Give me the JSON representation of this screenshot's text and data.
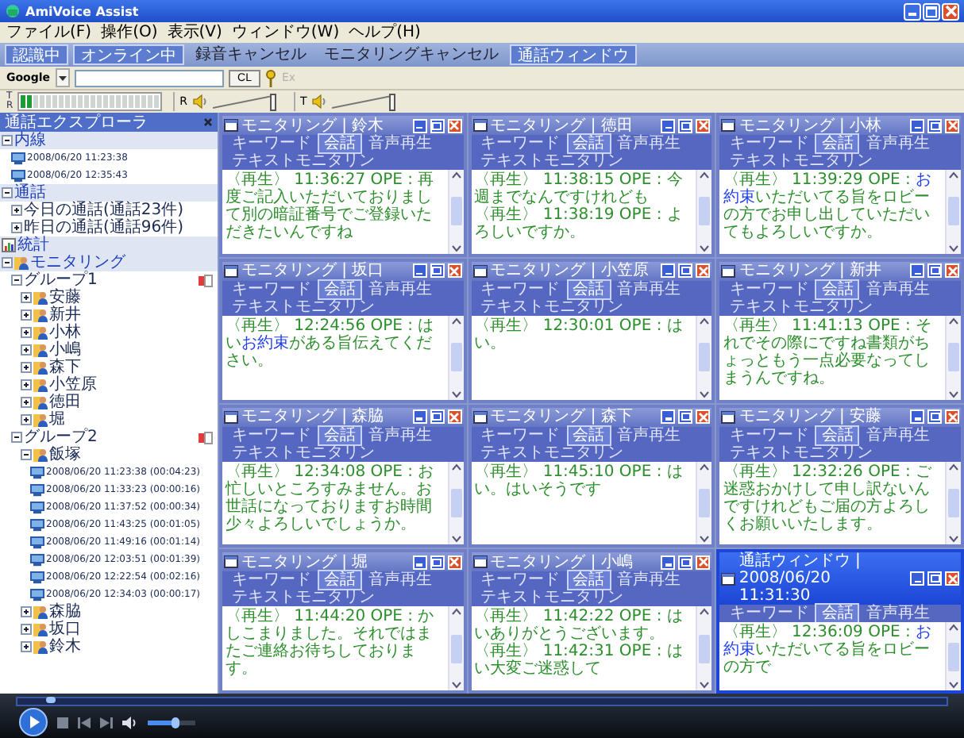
{
  "app_title": "AmiVoice Assist",
  "menu": [
    "ファイル(F)",
    "操作(O)",
    "表示(V)",
    "ウィンドウ(W)",
    "ヘルプ(H)"
  ],
  "toolbar": [
    {
      "label": "認識中",
      "on": true
    },
    {
      "label": "オンライン中",
      "on": true
    },
    {
      "label": "録音キャンセル",
      "on": false
    },
    {
      "label": "モニタリングキャンセル",
      "on": false
    },
    {
      "label": "通話ウィンドウ",
      "on": true
    }
  ],
  "search": {
    "engine": "Google",
    "button": "CL",
    "ex_button": {
      "label": "Ex",
      "disabled": true
    }
  },
  "meter": {
    "top_label": "T",
    "bottom_label": "R",
    "level": 0.1
  },
  "sliders": [
    {
      "label": "R",
      "level": 0.95
    },
    {
      "label": "T",
      "level": 0.95
    }
  ],
  "explorer": {
    "title": "通話エクスプローラ",
    "tree": [
      {
        "label": "内線",
        "kind": "section",
        "expanded": true,
        "children": [
          {
            "label": "2008/06/20 11:23:38",
            "kind": "record"
          },
          {
            "label": "2008/06/20 12:35:43",
            "kind": "record"
          }
        ]
      },
      {
        "label": "通話",
        "kind": "section",
        "expanded": true,
        "children": [
          {
            "label": "今日の通話(通話23件)",
            "kind": "folder",
            "expanded": false
          },
          {
            "label": "昨日の通話(通話96件)",
            "kind": "folder",
            "expanded": false
          }
        ]
      },
      {
        "label": "統計",
        "kind": "stats"
      },
      {
        "label": "モニタリング",
        "kind": "monitor",
        "expanded": true,
        "children": [
          {
            "label": "グループ1",
            "kind": "group",
            "expanded": true,
            "children": [
              {
                "label": "安藤",
                "kind": "person",
                "expanded": false
              },
              {
                "label": "新井",
                "kind": "person",
                "expanded": false
              },
              {
                "label": "小林",
                "kind": "person",
                "expanded": false
              },
              {
                "label": "小嶋",
                "kind": "person",
                "expanded": false
              },
              {
                "label": "森下",
                "kind": "person",
                "expanded": false
              },
              {
                "label": "小笠原",
                "kind": "person",
                "expanded": false
              },
              {
                "label": "徳田",
                "kind": "person",
                "expanded": false
              },
              {
                "label": "堀",
                "kind": "person",
                "expanded": false
              }
            ]
          },
          {
            "label": "グループ2",
            "kind": "group",
            "expanded": true,
            "children": [
              {
                "label": "飯塚",
                "kind": "person",
                "expanded": true,
                "children": [
                  {
                    "label": "2008/06/20 11:23:38 (00:04:23)",
                    "kind": "record"
                  },
                  {
                    "label": "2008/06/20 11:33:23 (00:00:16)",
                    "kind": "record"
                  },
                  {
                    "label": "2008/06/20 11:37:52 (00:00:34)",
                    "kind": "record"
                  },
                  {
                    "label": "2008/06/20 11:43:25 (00:01:05)",
                    "kind": "record"
                  },
                  {
                    "label": "2008/06/20 11:49:16 (00:01:14)",
                    "kind": "record"
                  },
                  {
                    "label": "2008/06/20 12:03:51 (00:01:39)",
                    "kind": "record"
                  },
                  {
                    "label": "2008/06/20 12:22:54 (00:02:16)",
                    "kind": "record"
                  },
                  {
                    "label": "2008/06/20 12:34:03 (00:00:17)",
                    "kind": "record"
                  }
                ]
              },
              {
                "label": "森脇",
                "kind": "person",
                "expanded": false
              },
              {
                "label": "坂口",
                "kind": "person",
                "expanded": false
              },
              {
                "label": "鈴木",
                "kind": "person",
                "expanded": false
              }
            ]
          }
        ]
      }
    ]
  },
  "windows": [
    {
      "title": "モニタリング | 鈴木",
      "active": false,
      "tabs": [
        {
          "label": "キーワード",
          "selected": false
        },
        {
          "label": "会話",
          "selected": true
        },
        {
          "label": "音声再生",
          "selected": false
        },
        {
          "label": "テキストモニタリン",
          "selected": false
        }
      ],
      "entries": [
        "〈再生〉 11:36:27 OPE : 再度ご記入いただいておりまして別の暗証番号でご登録いただきたいんですね"
      ]
    },
    {
      "title": "モニタリング | 徳田",
      "active": false,
      "tabs": [
        {
          "label": "キーワード",
          "selected": false
        },
        {
          "label": "会話",
          "selected": true
        },
        {
          "label": "音声再生",
          "selected": false
        },
        {
          "label": "テキストモニタリン",
          "selected": false
        }
      ],
      "entries": [
        "〈再生〉 11:38:15 OPE : 今週までなんですけれども",
        "〈再生〉 11:38:19 OPE : よろしいですか。"
      ]
    },
    {
      "title": "モニタリング | 小林",
      "active": false,
      "tabs": [
        {
          "label": "キーワード",
          "selected": false
        },
        {
          "label": "会話",
          "selected": true
        },
        {
          "label": "音声再生",
          "selected": false
        },
        {
          "label": "テキストモニタリン",
          "selected": false
        }
      ],
      "entries": [
        "〈再生〉 11:39:29 OPE : **お約束**いただいてる旨をロビーの方でお申し出していただいてもよろしいですか。"
      ]
    },
    {
      "title": "モニタリング | 坂口",
      "active": false,
      "tabs": [
        {
          "label": "キーワード",
          "selected": false
        },
        {
          "label": "会話",
          "selected": true
        },
        {
          "label": "音声再生",
          "selected": false
        },
        {
          "label": "テキストモニタリン",
          "selected": false
        }
      ],
      "entries": [
        "〈再生〉 12:24:56 OPE : はい**お約束**がある旨伝えてください。"
      ]
    },
    {
      "title": "モニタリング | 小笠原",
      "active": false,
      "tabs": [
        {
          "label": "キーワード",
          "selected": false
        },
        {
          "label": "会話",
          "selected": true
        },
        {
          "label": "音声再生",
          "selected": false
        },
        {
          "label": "テキストモニタリン",
          "selected": false
        }
      ],
      "entries": [
        "〈再生〉 12:30:01 OPE : はい。"
      ]
    },
    {
      "title": "モニタリング | 新井",
      "active": false,
      "tabs": [
        {
          "label": "キーワード",
          "selected": false
        },
        {
          "label": "会話",
          "selected": true
        },
        {
          "label": "音声再生",
          "selected": false
        },
        {
          "label": "テキストモニタリン",
          "selected": false
        }
      ],
      "entries": [
        "〈再生〉 11:41:13 OPE : それでその際にですね書類がちょっともう一点必要なってしまうんですね。"
      ]
    },
    {
      "title": "モニタリング | 森脇",
      "active": false,
      "tabs": [
        {
          "label": "キーワード",
          "selected": false
        },
        {
          "label": "会話",
          "selected": true
        },
        {
          "label": "音声再生",
          "selected": false
        },
        {
          "label": "テキストモニタリン",
          "selected": false
        }
      ],
      "entries": [
        "〈再生〉 12:34:08 OPE : お忙しいところすみません。お世話になっておりますお時間少々よろしいでしょうか。"
      ]
    },
    {
      "title": "モニタリング | 森下",
      "active": false,
      "tabs": [
        {
          "label": "キーワード",
          "selected": false
        },
        {
          "label": "会話",
          "selected": true
        },
        {
          "label": "音声再生",
          "selected": false
        },
        {
          "label": "テキストモニタリン",
          "selected": false
        }
      ],
      "entries": [
        "〈再生〉 11:45:10 OPE : はい。はいそうです"
      ]
    },
    {
      "title": "モニタリング | 安藤",
      "active": false,
      "tabs": [
        {
          "label": "キーワード",
          "selected": false
        },
        {
          "label": "会話",
          "selected": true
        },
        {
          "label": "音声再生",
          "selected": false
        },
        {
          "label": "テキストモニタリン",
          "selected": false
        }
      ],
      "entries": [
        "〈再生〉 12:32:26 OPE : ご迷惑おかけして申し訳ないんですけれどもご届の方よろしくお願いいたします。"
      ]
    },
    {
      "title": "モニタリング | 堀",
      "active": false,
      "tabs": [
        {
          "label": "キーワード",
          "selected": false
        },
        {
          "label": "会話",
          "selected": true
        },
        {
          "label": "音声再生",
          "selected": false
        },
        {
          "label": "テキストモニタリン",
          "selected": false
        }
      ],
      "entries": [
        "〈再生〉 11:44:20 OPE : かしこまりました。それではまたご連絡お待ちしております。"
      ]
    },
    {
      "title": "モニタリング | 小嶋",
      "active": false,
      "tabs": [
        {
          "label": "キーワード",
          "selected": false
        },
        {
          "label": "会話",
          "selected": true
        },
        {
          "label": "音声再生",
          "selected": false
        },
        {
          "label": "テキストモニタリン",
          "selected": false
        }
      ],
      "entries": [
        "〈再生〉 11:42:22 OPE : はいありがとうございます。",
        "〈再生〉 11:42:31 OPE : はい大変ご迷惑して"
      ]
    },
    {
      "title": "通話ウィンドウ | 2008/06/20 11:31:30",
      "active": true,
      "tabs": [
        {
          "label": "キーワード",
          "selected": false
        },
        {
          "label": "会話",
          "selected": true
        },
        {
          "label": "音声再生",
          "selected": false
        }
      ],
      "entries": [
        "〈再生〉 12:36:09 OPE : **お約束**いただいてる旨をロビーの方で"
      ]
    }
  ],
  "player": {
    "seek": {
      "level": 0.03
    },
    "volume": {
      "level": 0.55
    }
  }
}
